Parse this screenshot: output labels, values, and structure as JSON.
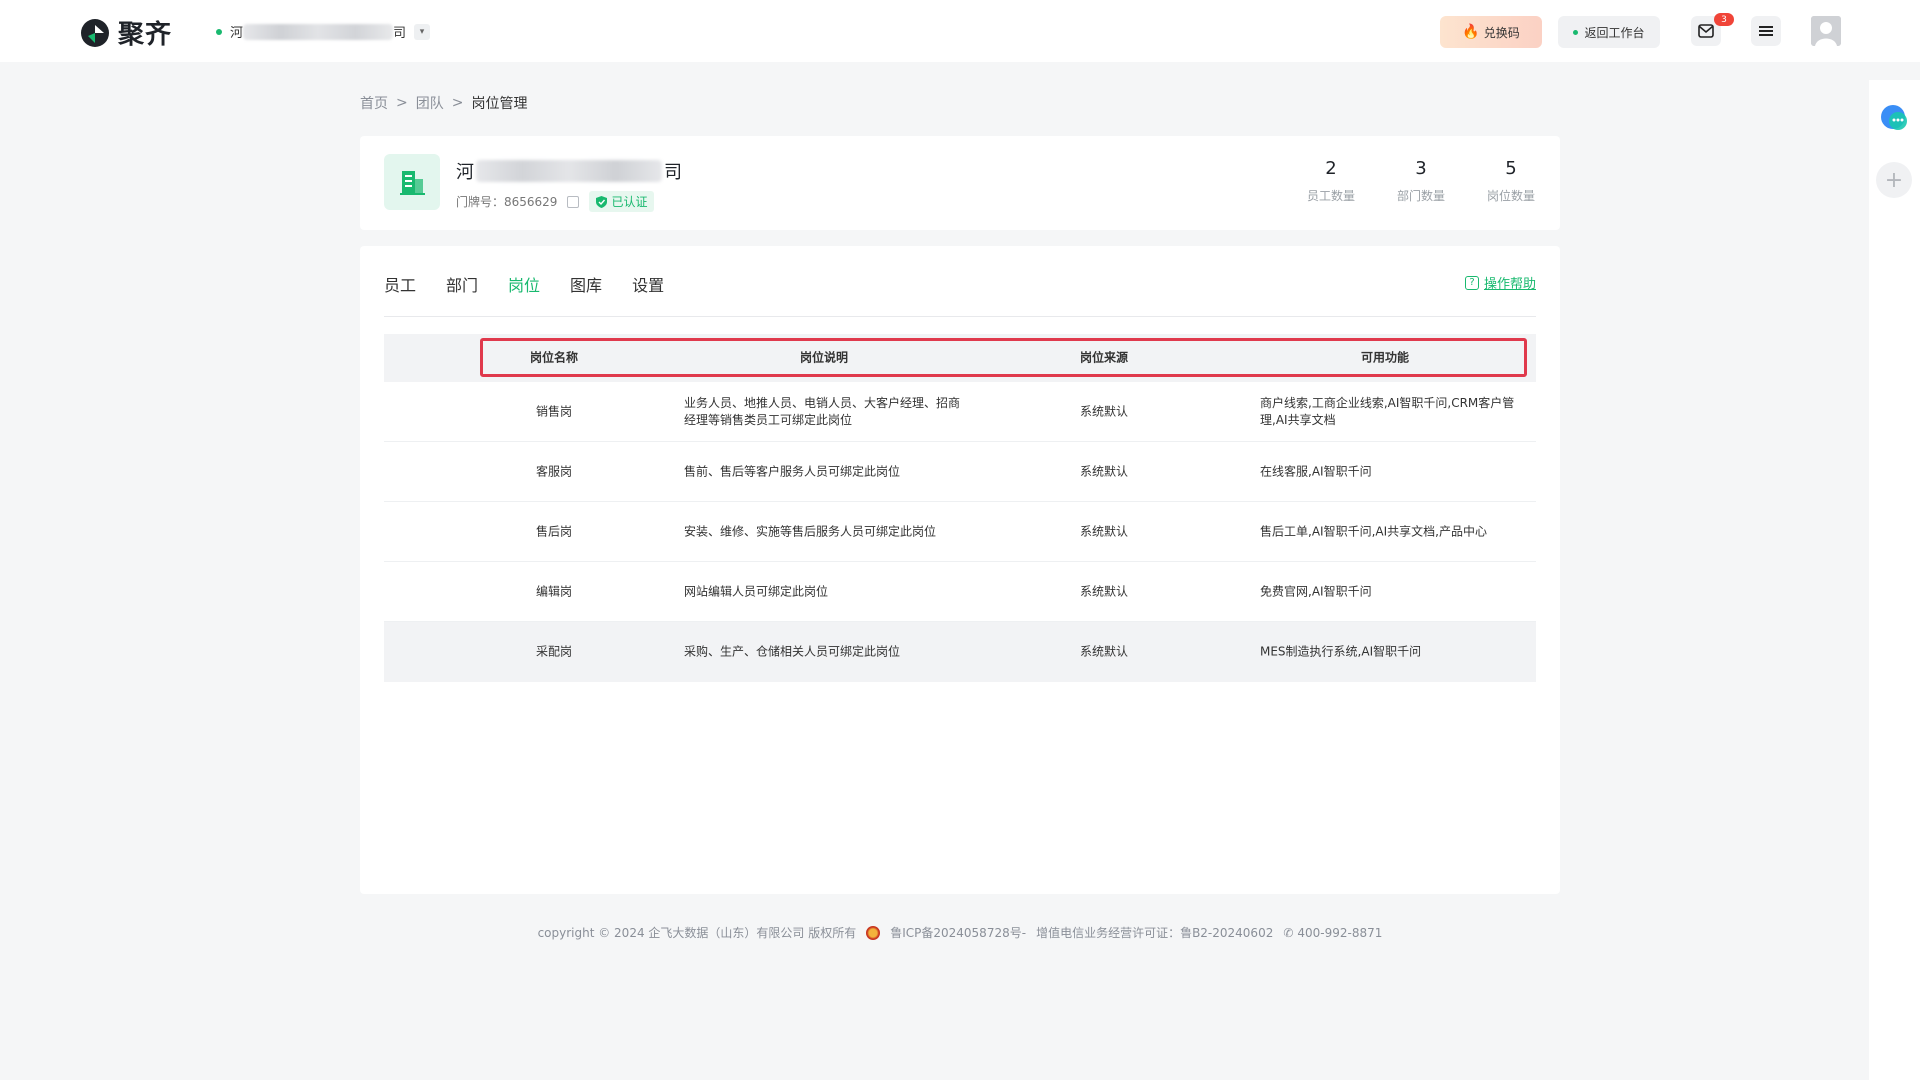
{
  "header": {
    "logo_text": "聚齐",
    "org_prefix": "河",
    "org_suffix": "司",
    "redeem_label": "兑换码",
    "back_label": "返回工作台",
    "mail_badge": "3"
  },
  "breadcrumb": {
    "home": "首页",
    "team": "团队",
    "current": "岗位管理",
    "sep": ">"
  },
  "company": {
    "name_prefix": "河",
    "name_suffix": "司",
    "door_label": "门牌号：8656629",
    "verified_label": "已认证",
    "stats": [
      {
        "num": "2",
        "label": "员工数量"
      },
      {
        "num": "3",
        "label": "部门数量"
      },
      {
        "num": "5",
        "label": "岗位数量"
      }
    ]
  },
  "tabs": [
    "员工",
    "部门",
    "岗位",
    "图库",
    "设置"
  ],
  "active_tab": "岗位",
  "help_label": "操作帮助",
  "table": {
    "headers": [
      "岗位名称",
      "岗位说明",
      "岗位来源",
      "可用功能"
    ],
    "rows": [
      [
        "销售岗",
        "业务人员、地推人员、电销人员、大客户经理、招商经理等销售类员工可绑定此岗位",
        "系统默认",
        "商户线索,工商企业线索,AI智职千问,CRM客户管理,AI共享文档"
      ],
      [
        "客服岗",
        "售前、售后等客户服务人员可绑定此岗位",
        "系统默认",
        "在线客服,AI智职千问"
      ],
      [
        "售后岗",
        "安装、维修、实施等售后服务人员可绑定此岗位",
        "系统默认",
        "售后工单,AI智职千问,AI共享文档,产品中心"
      ],
      [
        "编辑岗",
        "网站编辑人员可绑定此岗位",
        "系统默认",
        "免费官网,AI智职千问"
      ],
      [
        "采配岗",
        "采购、生产、仓储相关人员可绑定此岗位",
        "系统默认",
        "MES制造执行系统,AI智职千问"
      ]
    ]
  },
  "footer": {
    "copyright": "copyright © 2024 企飞大数据（山东）有限公司 版权所有",
    "icp": "鲁ICP备2024058728号-",
    "license": "增值电信业务经营许可证：鲁B2-20240602",
    "phone": "400-992-8871"
  },
  "colors": {
    "accent": "#19b96f",
    "highlight_box": "#e0394c"
  }
}
